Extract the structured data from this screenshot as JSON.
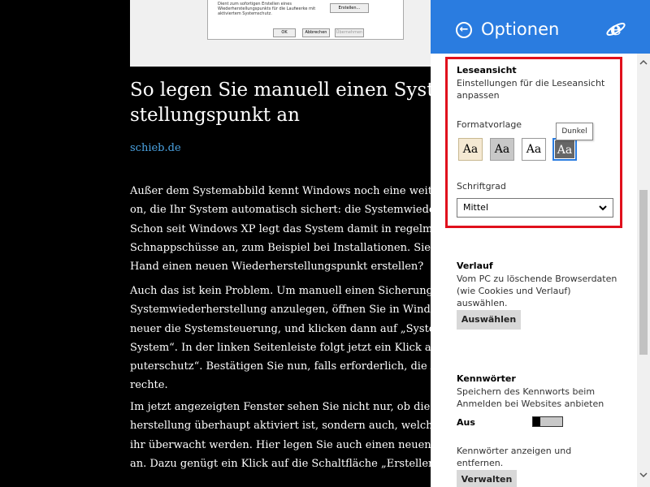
{
  "article": {
    "dialog": {
      "text": "Dient zum sofortigen Erstellen eines Wiederherstellungspunkts für die Laufwerke mit aktiviertem Systemschutz.",
      "create_label": "Erstellen...",
      "ok_label": "OK",
      "cancel_label": "Abbrechen",
      "apply_label": "Übernehmen"
    },
    "title_line1": "So legen Sie manuell einen Systemw",
    "title_line2": "stellungspunkt an",
    "source": "schieb.de",
    "paragraph1": [
      "Außer dem Systemabbild kennt Windows noch eine weite",
      "on, die Ihr System automatisch sichert: die Systemwieder",
      "Schon seit Windows XP legt das System damit in regelmä",
      "Schnappschüsse an, zum Beispiel bei Installationen. Sie m",
      "Hand einen neuen Wiederherstellungspunkt erstellen?"
    ],
    "paragraph2": [
      "Auch das ist kein Problem. Um manuell einen Sicherungsp",
      "Systemwiederherstellung anzulegen, öffnen Sie in Windo",
      "neuer die Systemsteuerung, und klicken dann auf „Systen",
      "System“. In der linken Seitenleiste folgt jetzt ein Klick au",
      "puterschutz“. Bestätigen Sie nun, falls erforderlich, die A",
      "rechte."
    ],
    "paragraph3": [
      "Im jetzt angezeigten Fenster sehen Sie nicht nur, ob die S",
      "herstellung überhaupt aktiviert ist, sondern auch, welche",
      "ihr überwacht werden. Hier legen Sie auch einen neuen S",
      "an. Dazu genügt ein Klick auf die Schaltfläche „Erstellen..."
    ]
  },
  "panel": {
    "title": "Optionen",
    "accent_color": "#2a7ce0",
    "highlight_color": "#e0101c",
    "back_icon": "back-arrow-circle-icon",
    "logo_icon": "internet-explorer-logo-icon",
    "reading_view": {
      "title": "Leseansicht",
      "description": "Einstellungen für die Leseansicht anpassen",
      "style_label": "Formatvorlage",
      "style_options": [
        "Aa",
        "Aa",
        "Aa",
        "Aa"
      ],
      "selected_style_tooltip": "Dunkel",
      "font_size_label": "Schriftgrad",
      "font_size_value": "Mittel"
    },
    "history": {
      "title": "Verlauf",
      "description": "Vom PC zu löschende Browserdaten (wie Cookies und Verlauf) auswählen.",
      "button_label": "Auswählen"
    },
    "passwords": {
      "title": "Kennwörter",
      "description": "Speichern des Kennworts beim Anmelden bei Websites anbieten",
      "toggle_label": "Aus",
      "toggle_on": false,
      "manage_text": "Kennwörter anzeigen und entfernen.",
      "button_label": "Verwalten"
    }
  }
}
